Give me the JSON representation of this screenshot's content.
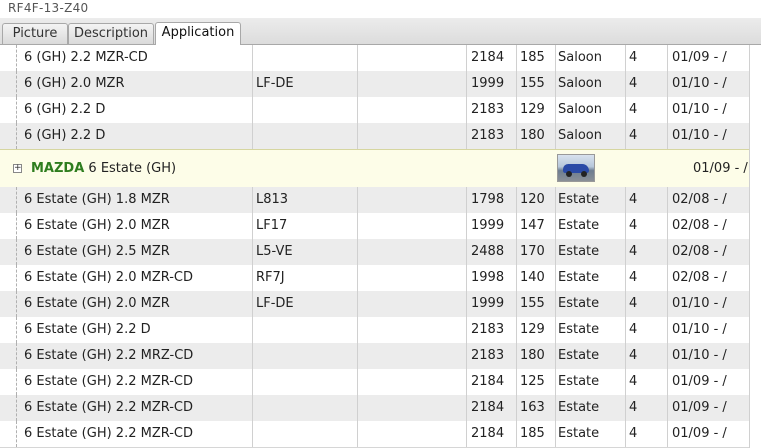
{
  "window": {
    "title": "RF4F-13-Z40"
  },
  "tabs": [
    {
      "label": "Picture",
      "active": false
    },
    {
      "label": "Description",
      "active": false
    },
    {
      "label": "Application",
      "active": true
    }
  ],
  "rows_top": [
    {
      "model": "6 (GH) 2.2 MZR-CD",
      "engine": "",
      "ccm": "2184",
      "kw": "185",
      "body": "Saloon",
      "doors": "4",
      "date": "01/09 - /"
    },
    {
      "model": "6 (GH) 2.0 MZR",
      "engine": "LF-DE",
      "ccm": "1999",
      "kw": "155",
      "body": "Saloon",
      "doors": "4",
      "date": "01/10 - /"
    },
    {
      "model": "6 (GH) 2.2 D",
      "engine": "",
      "ccm": "2183",
      "kw": "129",
      "body": "Saloon",
      "doors": "4",
      "date": "01/10 - /"
    },
    {
      "model": "6 (GH) 2.2 D",
      "engine": "",
      "ccm": "2183",
      "kw": "180",
      "body": "Saloon",
      "doors": "4",
      "date": "01/10 - /"
    }
  ],
  "group": {
    "expander": "+",
    "brand": "MAZDA",
    "model": "6 Estate (GH)",
    "date": "01/09 - /",
    "thumbnail_icon": "car-thumbnail"
  },
  "rows_bottom": [
    {
      "model": "6 Estate (GH) 1.8 MZR",
      "engine": "L813",
      "ccm": "1798",
      "kw": "120",
      "body": "Estate",
      "doors": "4",
      "date": "02/08 - /"
    },
    {
      "model": "6 Estate (GH) 2.0 MZR",
      "engine": "LF17",
      "ccm": "1999",
      "kw": "147",
      "body": "Estate",
      "doors": "4",
      "date": "02/08 - /"
    },
    {
      "model": "6 Estate (GH) 2.5 MZR",
      "engine": "L5-VE",
      "ccm": "2488",
      "kw": "170",
      "body": "Estate",
      "doors": "4",
      "date": "02/08 - /"
    },
    {
      "model": "6 Estate (GH) 2.0 MZR-CD",
      "engine": "RF7J",
      "ccm": "1998",
      "kw": "140",
      "body": "Estate",
      "doors": "4",
      "date": "02/08 - /"
    },
    {
      "model": "6 Estate (GH) 2.0 MZR",
      "engine": "LF-DE",
      "ccm": "1999",
      "kw": "155",
      "body": "Estate",
      "doors": "4",
      "date": "01/10 - /"
    },
    {
      "model": "6 Estate (GH) 2.2 D",
      "engine": "",
      "ccm": "2183",
      "kw": "129",
      "body": "Estate",
      "doors": "4",
      "date": "01/10 - /"
    },
    {
      "model": "6 Estate (GH) 2.2 MRZ-CD",
      "engine": "",
      "ccm": "2183",
      "kw": "180",
      "body": "Estate",
      "doors": "4",
      "date": "01/10 - /"
    },
    {
      "model": "6 Estate (GH) 2.2 MZR-CD",
      "engine": "",
      "ccm": "2184",
      "kw": "125",
      "body": "Estate",
      "doors": "4",
      "date": "01/09 - /"
    },
    {
      "model": "6 Estate (GH) 2.2 MZR-CD",
      "engine": "",
      "ccm": "2184",
      "kw": "163",
      "body": "Estate",
      "doors": "4",
      "date": "01/09 - /"
    },
    {
      "model": "6 Estate (GH) 2.2 MZR-CD",
      "engine": "",
      "ccm": "2184",
      "kw": "185",
      "body": "Estate",
      "doors": "4",
      "date": "01/09 - /"
    }
  ],
  "colors": {
    "brand": "#2e7d1e",
    "row_alt": "#ececec",
    "group_bg": "#fdfde8"
  }
}
